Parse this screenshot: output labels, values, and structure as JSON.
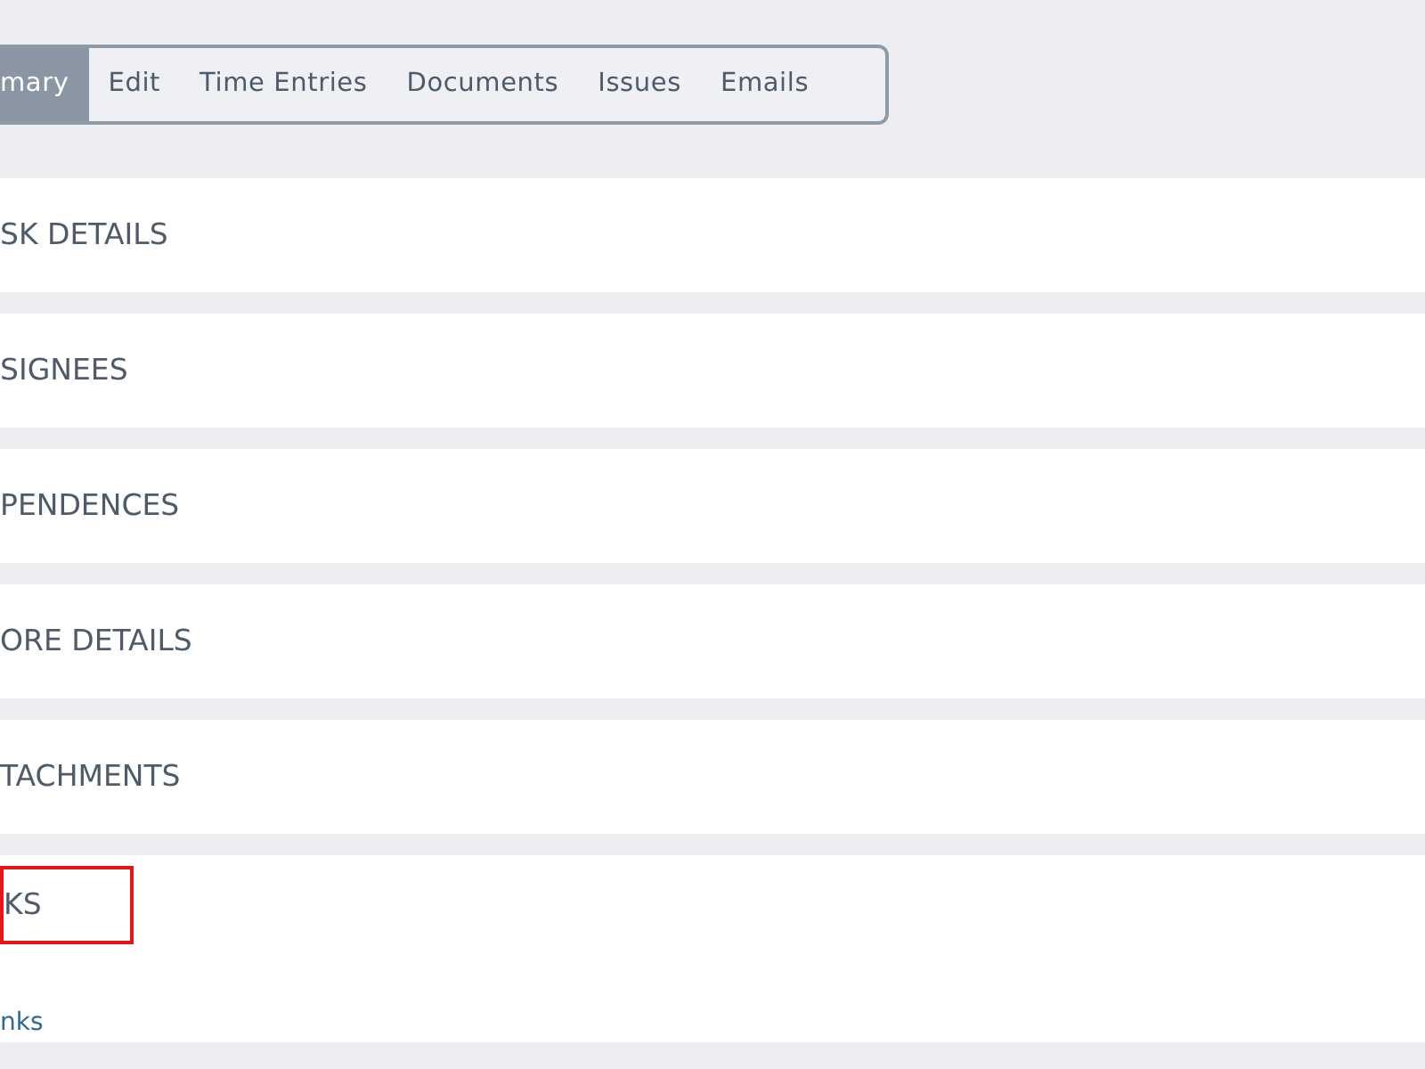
{
  "tabs": [
    {
      "label": "mary",
      "selected": true
    },
    {
      "label": "Edit",
      "selected": false
    },
    {
      "label": "Time Entries",
      "selected": false
    },
    {
      "label": "Documents",
      "selected": false
    },
    {
      "label": "Issues",
      "selected": false
    },
    {
      "label": "Emails",
      "selected": false
    }
  ],
  "sections": [
    {
      "title": "SK DETAILS",
      "highlighted": false
    },
    {
      "title": "SIGNEES",
      "highlighted": false
    },
    {
      "title": "PENDENCES",
      "highlighted": false
    },
    {
      "title": "ORE DETAILS",
      "highlighted": false
    },
    {
      "title": "TACHMENTS",
      "highlighted": false
    },
    {
      "title": "KS",
      "highlighted": true,
      "link": "nks"
    }
  ]
}
